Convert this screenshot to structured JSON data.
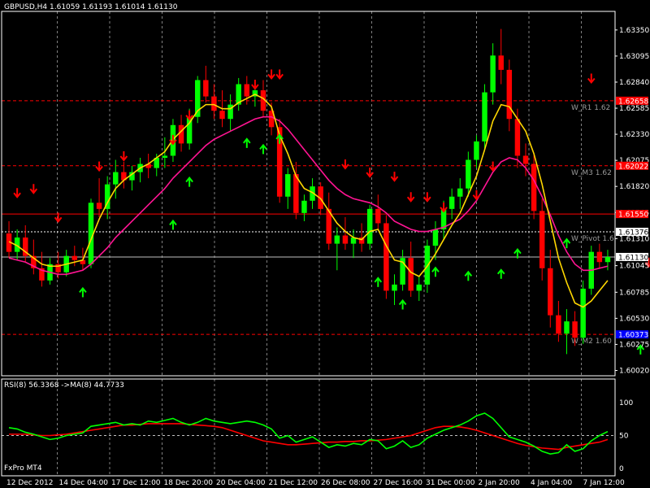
{
  "chart_data": [
    {
      "type": "candlestick",
      "title": "GBPUSD,H4  1.61059 1.61193 1.61014 1.61130",
      "symbol": "GBPUSD",
      "timeframe": "H4",
      "ylim": [
        1.6,
        1.635
      ],
      "y_ticks": [
        "1.63350",
        "1.63095",
        "1.62840",
        "1.62585",
        "1.62330",
        "1.62075",
        "1.61820",
        "1.61565",
        "1.61310",
        "1.61045",
        "1.60785",
        "1.60530",
        "1.60275",
        "1.60020"
      ],
      "x_labels": [
        "12 Dec 2012",
        "14 Dec 04:00",
        "17 Dec 12:00",
        "18 Dec 20:00",
        "20 Dec 04:00",
        "21 Dec 12:00",
        "26 Dec 08:00",
        "27 Dec 16:00",
        "31 Dec 00:00",
        "2 Jan 20:00",
        "4 Jan 04:00",
        "7 Jan 12:00"
      ],
      "x_label_positions": [
        0,
        22,
        44,
        66,
        88,
        110,
        132,
        154,
        176,
        198,
        220,
        242
      ],
      "price_labels": [
        {
          "value": "1.62658",
          "price": 1.62658,
          "color": "#ff0000",
          "text_color": "#ffffff"
        },
        {
          "value": "1.62022",
          "price": 1.62022,
          "color": "#ff0000",
          "text_color": "#ffffff"
        },
        {
          "value": "1.61550",
          "price": 1.6155,
          "color": "#ff0000",
          "text_color": "#ffffff"
        },
        {
          "value": "1.61376",
          "price": 1.61376,
          "color": "#ffffff",
          "text_color": "#000000"
        },
        {
          "value": "1.61130",
          "price": 1.6113,
          "color": "#ffffff",
          "text_color": "#000000"
        },
        {
          "value": "1.60373",
          "price": 1.60373,
          "color": "#0000ff",
          "text_color": "#ffffff"
        }
      ],
      "levels": [
        {
          "name": "W_R1 1.62",
          "price": 1.62658,
          "color": "#ff0000",
          "style": "dash"
        },
        {
          "name": "W_M3 1.62",
          "price": 1.62022,
          "color": "#ff0000",
          "style": "dash"
        },
        {
          "name": "",
          "price": 1.6155,
          "color": "#ff0000",
          "style": "solid"
        },
        {
          "name": "W_Pivot 1.6",
          "price": 1.61376,
          "color": "#ffffff",
          "style": "dot"
        },
        {
          "name": "",
          "price": 1.6113,
          "color": "#c0c0c0",
          "style": "solid"
        },
        {
          "name": "W_M2 1.60",
          "price": 1.60373,
          "color": "#ff0000",
          "style": "dash"
        }
      ],
      "candles": [
        [
          1.6136,
          1.6148,
          1.6112,
          1.6118
        ],
        [
          1.6118,
          1.614,
          1.611,
          1.6132
        ],
        [
          1.6132,
          1.6144,
          1.6108,
          1.6114
        ],
        [
          1.6114,
          1.613,
          1.6096,
          1.6102
        ],
        [
          1.6102,
          1.6118,
          1.6084,
          1.609
        ],
        [
          1.609,
          1.6112,
          1.6086,
          1.6106
        ],
        [
          1.6106,
          1.6118,
          1.6092,
          1.6098
        ],
        [
          1.6098,
          1.612,
          1.6094,
          1.6114
        ],
        [
          1.6114,
          1.6124,
          1.6104,
          1.611
        ],
        [
          1.611,
          1.6122,
          1.61,
          1.6106
        ],
        [
          1.6106,
          1.617,
          1.6102,
          1.6166
        ],
        [
          1.6166,
          1.619,
          1.6152,
          1.616
        ],
        [
          1.616,
          1.6192,
          1.615,
          1.6184
        ],
        [
          1.6184,
          1.6208,
          1.617,
          1.6196
        ],
        [
          1.6196,
          1.6206,
          1.618,
          1.6188
        ],
        [
          1.6188,
          1.6202,
          1.6178,
          1.6196
        ],
        [
          1.6196,
          1.621,
          1.6186,
          1.6204
        ],
        [
          1.6204,
          1.6214,
          1.619,
          1.62
        ],
        [
          1.62,
          1.6214,
          1.6192,
          1.621
        ],
        [
          1.621,
          1.623,
          1.62,
          1.6212
        ],
        [
          1.6212,
          1.6248,
          1.6206,
          1.6242
        ],
        [
          1.6242,
          1.6252,
          1.6216,
          1.6224
        ],
        [
          1.6224,
          1.6258,
          1.6218,
          1.625
        ],
        [
          1.625,
          1.629,
          1.6244,
          1.6286
        ],
        [
          1.6286,
          1.63,
          1.6264,
          1.627
        ],
        [
          1.627,
          1.6282,
          1.6248,
          1.6256
        ],
        [
          1.6256,
          1.6276,
          1.624,
          1.6248
        ],
        [
          1.6248,
          1.6272,
          1.6236,
          1.6262
        ],
        [
          1.6262,
          1.6288,
          1.6256,
          1.6282
        ],
        [
          1.6282,
          1.629,
          1.6262,
          1.627
        ],
        [
          1.627,
          1.6286,
          1.626,
          1.6276
        ],
        [
          1.6276,
          1.6286,
          1.625,
          1.6256
        ],
        [
          1.6256,
          1.6264,
          1.6232,
          1.624
        ],
        [
          1.624,
          1.6248,
          1.6166,
          1.6172
        ],
        [
          1.6172,
          1.62,
          1.616,
          1.6194
        ],
        [
          1.6194,
          1.6206,
          1.615,
          1.6156
        ],
        [
          1.6156,
          1.6174,
          1.6148,
          1.6168
        ],
        [
          1.6168,
          1.619,
          1.616,
          1.6182
        ],
        [
          1.6182,
          1.6186,
          1.6154,
          1.616
        ],
        [
          1.616,
          1.6176,
          1.612,
          1.6126
        ],
        [
          1.6126,
          1.6142,
          1.61,
          1.6134
        ],
        [
          1.6134,
          1.6152,
          1.612,
          1.6126
        ],
        [
          1.6126,
          1.614,
          1.6112,
          1.6132
        ],
        [
          1.6132,
          1.6146,
          1.6118,
          1.6126
        ],
        [
          1.6126,
          1.6164,
          1.612,
          1.616
        ],
        [
          1.616,
          1.6174,
          1.614,
          1.6146
        ],
        [
          1.6146,
          1.6154,
          1.6072,
          1.608
        ],
        [
          1.608,
          1.6096,
          1.6066,
          1.6086
        ],
        [
          1.6086,
          1.612,
          1.608,
          1.6112
        ],
        [
          1.6112,
          1.6128,
          1.6074,
          1.608
        ],
        [
          1.608,
          1.6094,
          1.607,
          1.6086
        ],
        [
          1.6086,
          1.613,
          1.6078,
          1.6124
        ],
        [
          1.6124,
          1.6148,
          1.611,
          1.614
        ],
        [
          1.614,
          1.6168,
          1.613,
          1.616
        ],
        [
          1.616,
          1.618,
          1.615,
          1.6172
        ],
        [
          1.6172,
          1.619,
          1.616,
          1.618
        ],
        [
          1.618,
          1.6216,
          1.6172,
          1.6208
        ],
        [
          1.6208,
          1.6232,
          1.62,
          1.6226
        ],
        [
          1.6226,
          1.6282,
          1.6218,
          1.6274
        ],
        [
          1.6274,
          1.6322,
          1.6262,
          1.631
        ],
        [
          1.631,
          1.6336,
          1.6282,
          1.6296
        ],
        [
          1.6296,
          1.6306,
          1.6236,
          1.6248
        ],
        [
          1.6248,
          1.6258,
          1.62,
          1.6212
        ],
        [
          1.6212,
          1.6224,
          1.6192,
          1.6204
        ],
        [
          1.6204,
          1.6214,
          1.615,
          1.6158
        ],
        [
          1.6158,
          1.617,
          1.609,
          1.6102
        ],
        [
          1.6102,
          1.612,
          1.6044,
          1.6056
        ],
        [
          1.6056,
          1.607,
          1.603,
          1.6038
        ],
        [
          1.6038,
          1.6062,
          1.6018,
          1.605
        ],
        [
          1.605,
          1.606,
          1.6026,
          1.6034
        ],
        [
          1.6034,
          1.609,
          1.6028,
          1.6082
        ],
        [
          1.6082,
          1.6124,
          1.6076,
          1.6118
        ],
        [
          1.6118,
          1.6126,
          1.6102,
          1.6108
        ],
        [
          1.6108,
          1.612,
          1.61,
          1.6113
        ]
      ],
      "ma_yellow": [
        1.6128,
        1.6124,
        1.6118,
        1.6112,
        1.6106,
        1.6104,
        1.6104,
        1.6106,
        1.6108,
        1.611,
        1.613,
        1.615,
        1.6166,
        1.618,
        1.6188,
        1.6194,
        1.62,
        1.6204,
        1.621,
        1.6216,
        1.6228,
        1.6236,
        1.6244,
        1.6256,
        1.6262,
        1.6262,
        1.6258,
        1.6258,
        1.6264,
        1.6268,
        1.6272,
        1.6268,
        1.626,
        1.6232,
        1.6214,
        1.6192,
        1.618,
        1.6176,
        1.617,
        1.6158,
        1.6146,
        1.6138,
        1.6132,
        1.613,
        1.6138,
        1.614,
        1.6124,
        1.611,
        1.6108,
        1.6098,
        1.6094,
        1.6104,
        1.6116,
        1.613,
        1.6144,
        1.6156,
        1.6174,
        1.6192,
        1.6218,
        1.6246,
        1.6262,
        1.626,
        1.6248,
        1.6236,
        1.6214,
        1.6184,
        1.6148,
        1.6112,
        1.6088,
        1.6068,
        1.6064,
        1.607,
        1.608,
        1.609
      ],
      "ma_magenta": [
        1.6112,
        1.611,
        1.6108,
        1.6104,
        1.61,
        1.6098,
        1.6096,
        1.6096,
        1.6098,
        1.61,
        1.6106,
        1.6114,
        1.6122,
        1.6132,
        1.614,
        1.6148,
        1.6156,
        1.6164,
        1.6172,
        1.618,
        1.619,
        1.6198,
        1.6206,
        1.6214,
        1.6222,
        1.6228,
        1.6232,
        1.6236,
        1.624,
        1.6244,
        1.6248,
        1.625,
        1.625,
        1.6246,
        1.6238,
        1.6228,
        1.6218,
        1.6208,
        1.6198,
        1.6188,
        1.618,
        1.6174,
        1.617,
        1.6168,
        1.6166,
        1.6162,
        1.6156,
        1.6148,
        1.6144,
        1.614,
        1.6138,
        1.6138,
        1.614,
        1.6142,
        1.6146,
        1.615,
        1.6158,
        1.6168,
        1.6182,
        1.6196,
        1.6206,
        1.621,
        1.6208,
        1.62,
        1.6188,
        1.6172,
        1.6154,
        1.6134,
        1.6118,
        1.6106,
        1.61,
        1.61,
        1.6102,
        1.6104
      ],
      "arrows_down": [
        [
          1,
          1.6174
        ],
        [
          3,
          1.6178
        ],
        [
          6,
          1.615
        ],
        [
          11,
          1.62
        ],
        [
          14,
          1.621
        ],
        [
          20,
          1.6226
        ],
        [
          22,
          1.625
        ],
        [
          30,
          1.628
        ],
        [
          32,
          1.629
        ],
        [
          33,
          1.629
        ],
        [
          41,
          1.6202
        ],
        [
          44,
          1.6194
        ],
        [
          47,
          1.619
        ],
        [
          49,
          1.617
        ],
        [
          51,
          1.617
        ],
        [
          53,
          1.616
        ],
        [
          57,
          1.6172
        ],
        [
          59,
          1.62
        ],
        [
          71,
          1.6286
        ],
        [
          78,
          1.6106
        ]
      ],
      "arrows_up": [
        [
          9,
          1.608
        ],
        [
          20,
          1.6146
        ],
        [
          22,
          1.6188
        ],
        [
          29,
          1.6226
        ],
        [
          31,
          1.622
        ],
        [
          33,
          1.623
        ],
        [
          45,
          1.609
        ],
        [
          48,
          1.6068
        ],
        [
          52,
          1.61
        ],
        [
          56,
          1.6096
        ],
        [
          60,
          1.6098
        ],
        [
          62,
          1.6118
        ],
        [
          68,
          1.6128
        ],
        [
          77,
          1.6024
        ],
        [
          79,
          1.6034
        ],
        [
          81,
          1.604
        ]
      ],
      "rsi_panel": {
        "title": "RSI(8) 56.3368  ->MA(8) 44.7733",
        "ylim": [
          0,
          100
        ],
        "y_ticks": [
          "100",
          "50",
          "0"
        ],
        "rsi": [
          62,
          60,
          55,
          52,
          48,
          44,
          46,
          50,
          52,
          54,
          64,
          66,
          68,
          70,
          66,
          68,
          66,
          72,
          70,
          73,
          76,
          70,
          66,
          70,
          76,
          72,
          70,
          68,
          70,
          72,
          70,
          66,
          60,
          46,
          50,
          40,
          44,
          48,
          40,
          32,
          36,
          34,
          38,
          36,
          44,
          42,
          30,
          34,
          42,
          32,
          36,
          46,
          52,
          58,
          62,
          66,
          72,
          80,
          84,
          76,
          62,
          48,
          44,
          40,
          34,
          26,
          22,
          24,
          36,
          26,
          30,
          42,
          50,
          56
        ],
        "rsi_ma": [
          52,
          52,
          52,
          51,
          50,
          50,
          51,
          52,
          54,
          56,
          58,
          60,
          62,
          64,
          66,
          66,
          67,
          68,
          68,
          68,
          68,
          68,
          67,
          66,
          65,
          64,
          62,
          58,
          54,
          50,
          46,
          42,
          40,
          38,
          36,
          36,
          37,
          38,
          39,
          40,
          40,
          41,
          41,
          42,
          42,
          43,
          44,
          46,
          48,
          50,
          54,
          58,
          62,
          64,
          64,
          63,
          61,
          58,
          54,
          50,
          46,
          42,
          38,
          35,
          33,
          31,
          30,
          29,
          32,
          34,
          36,
          38,
          40,
          44
        ],
        "color_rsi": "#00ff00",
        "color_ma": "#ff0000"
      },
      "footer_label": "FxPro MT4",
      "colors": {
        "bull": "#00ff00",
        "bear": "#ff0000",
        "ma_fast": "#ffd700",
        "ma_slow": "#ff1493",
        "grid": "#808080",
        "axis": "#ffffff"
      }
    }
  ]
}
